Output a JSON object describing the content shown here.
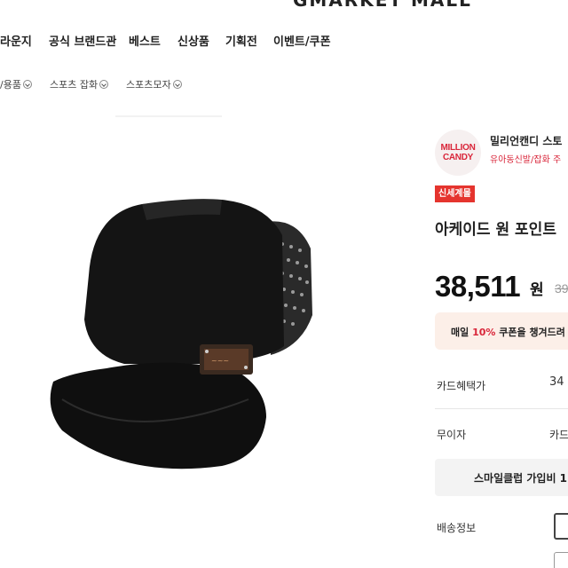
{
  "header": {
    "store_title": "GMARKET MALL"
  },
  "nav": {
    "items": [
      "라운지",
      "공식 브랜드관",
      "베스트",
      "신상품",
      "기획전",
      "이벤트/쿠폰"
    ]
  },
  "breadcrumbs": [
    "/용품",
    "스포츠 잡화",
    "스포츠모자"
  ],
  "product_image": {
    "alt": "black cap",
    "main_color": "#141414"
  },
  "seller": {
    "logo_line1": "MILLION",
    "logo_line2": "CANDY",
    "name": "밀리언캔디 스토",
    "sub": "유아동신발/잡화 주"
  },
  "badge": "신세계몰",
  "product": {
    "title": "아케이드 원 포인트",
    "price": "38,511",
    "currency": "원",
    "original_price": "39"
  },
  "coupon": {
    "prefix": "매일 ",
    "highlight": "10%",
    "suffix": " 쿠폰을 챙겨드려"
  },
  "info": {
    "card_label": "카드혜택가",
    "card_value": "34",
    "interest_label": "무이자",
    "interest_value": "카드",
    "shipping_label": "배송정보"
  },
  "smile_club": {
    "label": "스마일클럽 가입비 1"
  },
  "colors": {
    "accent": "#e5342e",
    "brand_red": "#d9263a",
    "coupon_bg": "#fcefe8"
  }
}
